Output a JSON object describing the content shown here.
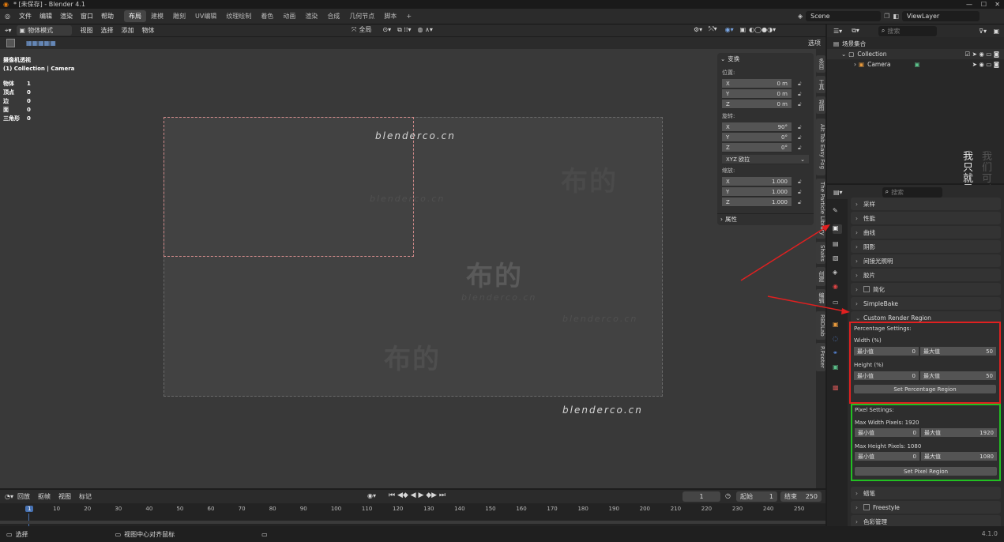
{
  "titlebar": {
    "title": "* [未保存] - Blender 4.1"
  },
  "menu": [
    "文件",
    "编辑",
    "渲染",
    "窗口",
    "帮助"
  ],
  "workspaces": [
    "布局",
    "建模",
    "雕刻",
    "UV编辑",
    "纹理绘制",
    "着色",
    "动画",
    "渲染",
    "合成",
    "几何节点",
    "脚本"
  ],
  "workspace_active": "布局",
  "scene": {
    "name": "Scene",
    "viewlayer": "ViewLayer"
  },
  "viewport_header": {
    "mode": "物体模式",
    "items": [
      "视图",
      "选择",
      "添加",
      "物体"
    ],
    "orientation": "全局",
    "options_label": "选项"
  },
  "viewport_info": {
    "title": "摄像机透视",
    "subtitle": "(1) Collection | Camera",
    "stats": [
      {
        "label": "物体",
        "value": "1"
      },
      {
        "label": "顶点",
        "value": "0"
      },
      {
        "label": "边",
        "value": "0"
      },
      {
        "label": "面",
        "value": "0"
      },
      {
        "label": "三角形",
        "value": "0"
      }
    ]
  },
  "watermarks": {
    "site": "blenderco.cn",
    "brand": "布的"
  },
  "npanel": {
    "transform_label": "变换",
    "location_label": "位置:",
    "location": [
      {
        "axis": "X",
        "value": "0 m"
      },
      {
        "axis": "Y",
        "value": "0 m"
      },
      {
        "axis": "Z",
        "value": "0 m"
      }
    ],
    "rotation_label": "旋转:",
    "rotation": [
      {
        "axis": "X",
        "value": "90°"
      },
      {
        "axis": "Y",
        "value": "0°"
      },
      {
        "axis": "Z",
        "value": "0°"
      }
    ],
    "rotation_mode": "XYZ 欧拉",
    "scale_label": "缩放:",
    "scale": [
      {
        "axis": "X",
        "value": "1.000"
      },
      {
        "axis": "Y",
        "value": "1.000"
      },
      {
        "axis": "Z",
        "value": "1.000"
      }
    ],
    "properties_label": "属性"
  },
  "vertical_tabs": [
    "条目",
    "工具",
    "视图",
    "Alt Tab Easy Fog",
    "The Particle Library",
    "Shaks",
    "创建",
    "编辑",
    "RBDLab",
    "P.Pooter"
  ],
  "outliner": {
    "search_placeholder": "搜索",
    "root": "场景集合",
    "collection": "Collection",
    "camera": "Camera"
  },
  "overlay_text": {
    "line1": "我只就是因为我觉得舍",
    "line2": "我们可以"
  },
  "properties": {
    "search_placeholder": "搜索",
    "panels_top": [
      "采样",
      "性能",
      "曲线",
      "阴影",
      "间接光照明",
      "胶片",
      "简化",
      "SimpleBake"
    ],
    "custom_panel": "Custom Render Region",
    "percentage": {
      "title": "Percentage Settings:",
      "width_label": "Width (%)",
      "height_label": "Height (%)",
      "min_label": "最小值",
      "max_label": "最大值",
      "width_min": "0",
      "width_max": "50",
      "height_min": "0",
      "height_max": "50",
      "button": "Set Percentage Region"
    },
    "pixel": {
      "title": "Pixel Settings:",
      "max_width_label": "Max Width Pixels: 1920",
      "max_height_label": "Max Height Pixels: 1080",
      "min_label": "最小值",
      "max_label": "最大值",
      "width_min": "0",
      "width_max": "1920",
      "height_min": "0",
      "height_max": "1080",
      "button": "Set Pixel Region"
    },
    "panels_bottom": [
      "蜡笔",
      "Freestyle",
      "色彩管理"
    ]
  },
  "timeline": {
    "menu": [
      "回放",
      "抠帧",
      "视图",
      "标记"
    ],
    "current_frame": "1",
    "start_label": "起始",
    "start": "1",
    "end_label": "结束",
    "end": "250",
    "ticks": [
      "1",
      "10",
      "20",
      "30",
      "40",
      "50",
      "60",
      "70",
      "80",
      "90",
      "100",
      "110",
      "120",
      "130",
      "140",
      "150",
      "160",
      "170",
      "180",
      "190",
      "200",
      "210",
      "220",
      "230",
      "240",
      "250"
    ]
  },
  "statusbar": {
    "left": "选择",
    "mid": "视图中心对齐鼠标",
    "version": "4.1.0"
  },
  "colors": {
    "accent": "#4772b3",
    "red_highlight": "#e02020",
    "green_highlight": "#22c022",
    "arrow": "#e02020"
  }
}
